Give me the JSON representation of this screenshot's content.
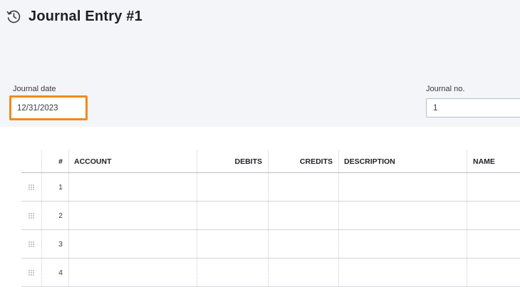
{
  "header": {
    "title": "Journal Entry #1",
    "icon": "history-icon"
  },
  "form": {
    "journal_date_label": "Journal date",
    "journal_date_value": "12/31/2023",
    "journal_no_label": "Journal no.",
    "journal_no_value": "1"
  },
  "colors": {
    "highlight": "#f28a1b",
    "header_bg": "#f4f5f8"
  },
  "table": {
    "columns": [
      "#",
      "ACCOUNT",
      "DEBITS",
      "CREDITS",
      "DESCRIPTION",
      "NAME"
    ],
    "rows": [
      {
        "num": "1",
        "account": "",
        "debits": "",
        "credits": "",
        "description": "",
        "name": ""
      },
      {
        "num": "2",
        "account": "",
        "debits": "",
        "credits": "",
        "description": "",
        "name": ""
      },
      {
        "num": "3",
        "account": "",
        "debits": "",
        "credits": "",
        "description": "",
        "name": ""
      },
      {
        "num": "4",
        "account": "",
        "debits": "",
        "credits": "",
        "description": "",
        "name": ""
      }
    ],
    "row_handle_icon": "drag-handle-icon"
  }
}
